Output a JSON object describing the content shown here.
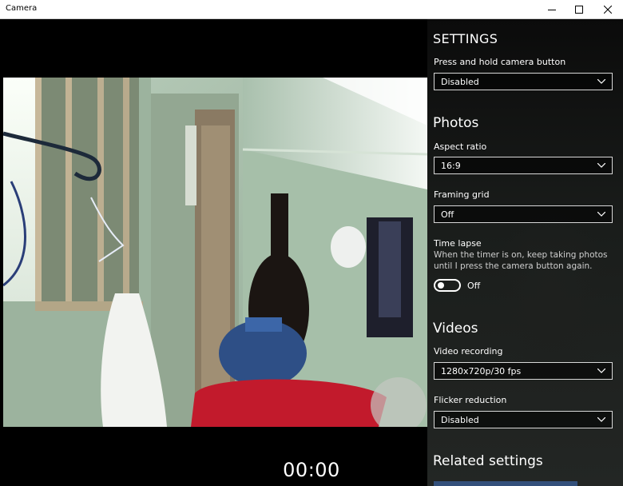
{
  "window": {
    "title": "Camera",
    "controls": [
      "minimize-icon",
      "maximize-icon",
      "close-icon"
    ]
  },
  "timer": "00:00",
  "settings": {
    "heading": "SETTINGS",
    "camera_button": {
      "label": "Press and hold camera button",
      "value": "Disabled"
    },
    "photos": {
      "heading": "Photos",
      "aspect_ratio": {
        "label": "Aspect ratio",
        "value": "16:9"
      },
      "framing_grid": {
        "label": "Framing grid",
        "value": "Off"
      },
      "time_lapse": {
        "label": "Time lapse",
        "description": "When the timer is on, keep taking photos until I press the camera button again.",
        "state": "Off"
      }
    },
    "videos": {
      "heading": "Videos",
      "video_recording": {
        "label": "Video recording",
        "value": "1280x720p/30 fps"
      },
      "flicker_reduction": {
        "label": "Flicker reduction",
        "value": "Disabled"
      }
    },
    "related": {
      "heading": "Related settings"
    }
  },
  "colors": {
    "titlebar_bg": "#ffffff",
    "background": "#000000",
    "text": "#ffffff",
    "dropdown_border": "#d8d8d8",
    "link": "#3d6db5"
  }
}
